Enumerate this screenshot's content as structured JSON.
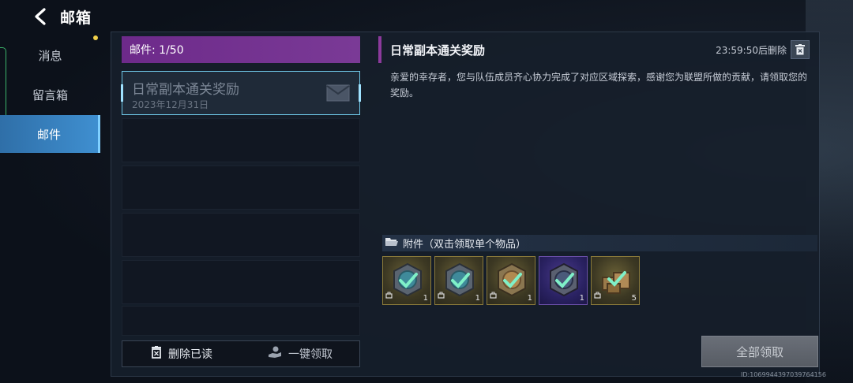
{
  "header": {
    "title": "邮箱",
    "back_icon": "chevron-left-icon"
  },
  "tabs": [
    {
      "label": "消息",
      "active": false,
      "has_dot": true
    },
    {
      "label": "留言箱",
      "active": false
    },
    {
      "label": "邮件",
      "active": true
    }
  ],
  "mail_list": {
    "header": "邮件: 1/50",
    "items": [
      {
        "title": "日常副本通关奖励",
        "date": "2023年12月31日",
        "icon": "envelope-icon"
      }
    ],
    "empty_slots": 5,
    "delete_read_label": "删除已读",
    "collect_one_label": "一键领取"
  },
  "detail": {
    "title": "日常副本通关奖励",
    "expiry": "23:59:50后删除",
    "body": "亲爱的幸存者，您与队伍成员齐心协力完成了对应区域探索，感谢您为联盟所做的贡献，请领取您的奖励。",
    "attachments_label": "附件（双击领取单个物品）",
    "items": [
      {
        "name": "gold-crate",
        "quantity": "1",
        "rarity": "gold",
        "color": "#8a7a3a"
      },
      {
        "name": "gold-crate",
        "quantity": "1",
        "rarity": "gold",
        "color": "#8a7a3a"
      },
      {
        "name": "bronze-crate",
        "quantity": "1",
        "rarity": "gold",
        "color": "#8a7a3a"
      },
      {
        "name": "purple-crate",
        "quantity": "1",
        "rarity": "purple",
        "color": "#6a4fa8"
      },
      {
        "name": "supply-boxes",
        "quantity": "5",
        "rarity": "gold",
        "color": "#8a7a3a"
      }
    ],
    "collect_all_label": "全部领取"
  },
  "footer": {
    "id": "ID:1069944397039764156"
  },
  "colors": {
    "accent_purple": "#7a3a96",
    "active_tab": "#3f8fd0",
    "selection": "#6fc8e8"
  }
}
